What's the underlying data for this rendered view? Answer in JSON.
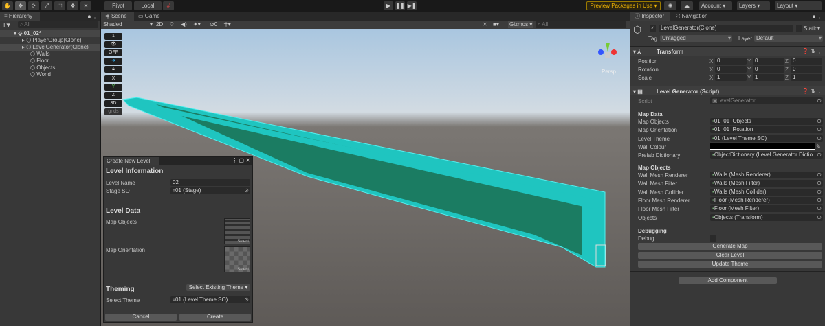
{
  "toolbar": {
    "pivot": "Pivot",
    "local": "Local",
    "preview": "Preview Packages in Use",
    "account": "Account",
    "layers": "Layers",
    "layout": "Layout",
    "tools": [
      "hand-icon",
      "move-icon",
      "rotate-icon",
      "scale-icon",
      "rect-icon",
      "transform-icon",
      "custom-tool-icon"
    ]
  },
  "colors": {
    "accent": "#f0b400",
    "level": "#1fc5c0",
    "panel": "#383838"
  },
  "hierarchy": {
    "title": "Hierarchy",
    "search_placeholder": "All",
    "items": [
      {
        "label": "01_02*",
        "depth": 0,
        "bold": true
      },
      {
        "label": "PlayerGroup(Clone)",
        "depth": 1
      },
      {
        "label": "LevelGenerator(Clone)",
        "depth": 1,
        "selected": true
      },
      {
        "label": "Walls",
        "depth": 2
      },
      {
        "label": "Floor",
        "depth": 2
      },
      {
        "label": "Objects",
        "depth": 2
      },
      {
        "label": "World",
        "depth": 2
      }
    ]
  },
  "scene": {
    "tabs": [
      "Scene",
      "Game"
    ],
    "shading": "Shaded",
    "mode2d": "2D",
    "gizmos": "Gizmos",
    "search_placeholder": "All",
    "hidden_count": "0",
    "persp": "Persp",
    "overlay": [
      "1",
      "OFF",
      "X",
      "Y",
      "Z",
      "3D",
      "grids"
    ]
  },
  "create_window": {
    "title": "Create New Level",
    "level_info": "Level Information",
    "level_name_label": "Level Name",
    "level_name": "02",
    "stage_label": "Stage SO",
    "stage": "01 (Stage)",
    "level_data": "Level Data",
    "map_objects": "Map Objects",
    "map_orientation": "Map Orientation",
    "select": "Select",
    "theming": "Theming",
    "theme_dropdown": "Select Existing Theme",
    "select_theme_label": "Select Theme",
    "select_theme": "01 (Level Theme SO)",
    "cancel": "Cancel",
    "create": "Create"
  },
  "inspector": {
    "tabs": [
      "Inspector",
      "Navigation"
    ],
    "object_name": "LevelGenerator(Clone)",
    "static": "Static",
    "tag_label": "Tag",
    "tag": "Untagged",
    "layer_label": "Layer",
    "layer": "Default",
    "transform": {
      "title": "Transform",
      "rows": [
        {
          "label": "Position",
          "x": "0",
          "y": "0",
          "z": "0"
        },
        {
          "label": "Rotation",
          "x": "0",
          "y": "0",
          "z": "0"
        },
        {
          "label": "Scale",
          "x": "1",
          "y": "1",
          "z": "1"
        }
      ]
    },
    "script": {
      "title": "Level Generator (Script)",
      "script_label": "Script",
      "script_value": "LevelGenerator",
      "map_data": "Map Data",
      "map_data_rows": [
        {
          "label": "Map Objects",
          "value": "01_01_Objects"
        },
        {
          "label": "Map Orientation",
          "value": "01_01_Rotation"
        },
        {
          "label": "Level Theme",
          "value": "01 (Level Theme SO)"
        },
        {
          "label": "Wall Colour",
          "value": ""
        },
        {
          "label": "Prefab Dictionary",
          "value": "ObjectDictionary (Level Generator Dictio"
        }
      ],
      "map_objects": "Map Objects",
      "map_objects_rows": [
        {
          "label": "Wall Mesh Renderer",
          "value": "Walls (Mesh Renderer)"
        },
        {
          "label": "Wall Mesh Filter",
          "value": "Walls (Mesh Filter)"
        },
        {
          "label": "Wall Mesh Collider",
          "value": "Walls (Mesh Collider)"
        },
        {
          "label": "Floor Mesh Renderer",
          "value": "Floor (Mesh Renderer)"
        },
        {
          "label": "Floor Mesh Filter",
          "value": "Floor (Mesh Filter)"
        },
        {
          "label": "Objects",
          "value": "Objects (Transform)"
        }
      ],
      "debugging": "Debugging",
      "debug_label": "Debug",
      "debug": false,
      "generate": "Generate Map",
      "clear": "Clear Level",
      "update": "Update Theme"
    },
    "add_component": "Add Component"
  }
}
